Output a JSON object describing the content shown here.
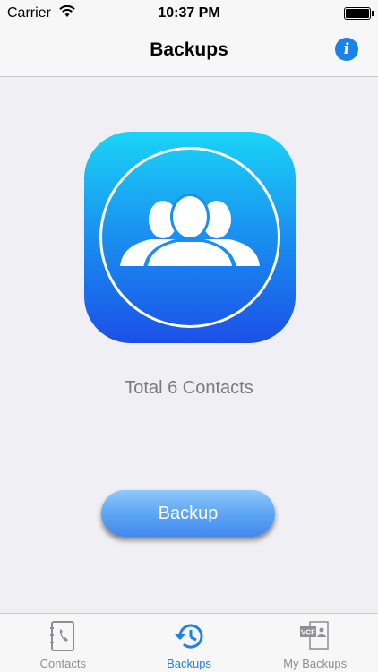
{
  "status_bar": {
    "carrier": "Carrier",
    "time": "10:37 PM",
    "battery_level": 1.0
  },
  "nav": {
    "title": "Backups",
    "info_icon": "info-icon",
    "info_glyph": "i"
  },
  "main": {
    "icon": "contacts-group-icon",
    "total_text": "Total 6 Contacts",
    "backup_label": "Backup"
  },
  "tabs": [
    {
      "label": "Contacts",
      "icon": "contacts-book-icon",
      "active": false
    },
    {
      "label": "Backups",
      "icon": "backup-history-icon",
      "active": true
    },
    {
      "label": "My Backups",
      "icon": "vcf-file-icon",
      "active": false,
      "icon_text": "VCF"
    }
  ],
  "colors": {
    "accent": "#1a82e8",
    "icon_gradient_top": "#1ad4f7",
    "icon_gradient_bottom": "#1b50e8",
    "button": "#5aa3f3"
  }
}
